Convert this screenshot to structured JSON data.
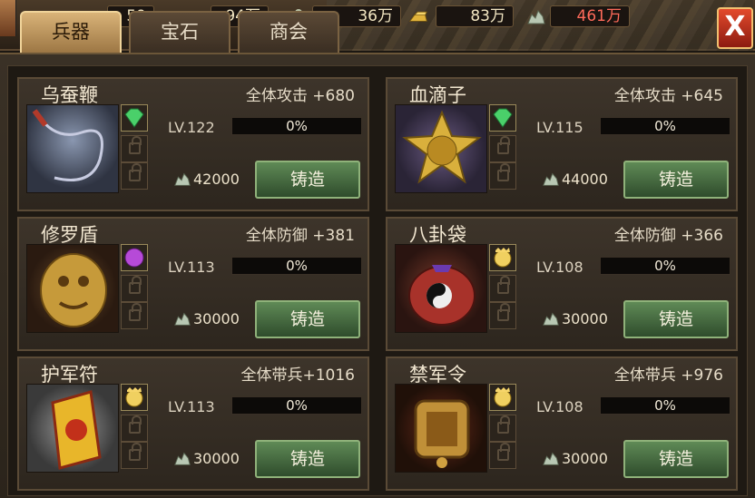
{
  "resources": [
    {
      "value": "59",
      "icon": "coin-icon"
    },
    {
      "value": "94万",
      "icon": "food-icon"
    },
    {
      "value": "36万",
      "icon": "soldier-icon"
    },
    {
      "value": "83万",
      "icon": "gold-bar-icon"
    },
    {
      "value": "461万",
      "icon": "silver-ore-icon"
    }
  ],
  "tabs": [
    {
      "label": "兵器",
      "active": true
    },
    {
      "label": "宝石",
      "active": false
    },
    {
      "label": "商会",
      "active": false
    }
  ],
  "close_label": "X",
  "items": [
    {
      "name": "乌蚕鞭",
      "stat": "全体攻击 +680",
      "level": "LV.122",
      "progress": "0%",
      "cost": "42000",
      "forge_label": "铸造",
      "gem": "green-gem-icon"
    },
    {
      "name": "血滴子",
      "stat": "全体攻击 +645",
      "level": "LV.115",
      "progress": "0%",
      "cost": "44000",
      "forge_label": "铸造",
      "gem": "green-gem-icon"
    },
    {
      "name": "修罗盾",
      "stat": "全体防御 +381",
      "level": "LV.113",
      "progress": "0%",
      "cost": "30000",
      "forge_label": "铸造",
      "gem": "purple-gem-icon"
    },
    {
      "name": "八卦袋",
      "stat": "全体防御 +366",
      "level": "LV.108",
      "progress": "0%",
      "cost": "30000",
      "forge_label": "铸造",
      "gem": "gold-gem-icon"
    },
    {
      "name": "护军符",
      "stat": "全体带兵+1016",
      "level": "LV.113",
      "progress": "0%",
      "cost": "30000",
      "forge_label": "铸造",
      "gem": "gold-gem-icon"
    },
    {
      "name": "禁军令",
      "stat": "全体带兵 +976",
      "level": "LV.108",
      "progress": "0%",
      "cost": "30000",
      "forge_label": "铸造",
      "gem": "gold-gem-icon"
    }
  ]
}
